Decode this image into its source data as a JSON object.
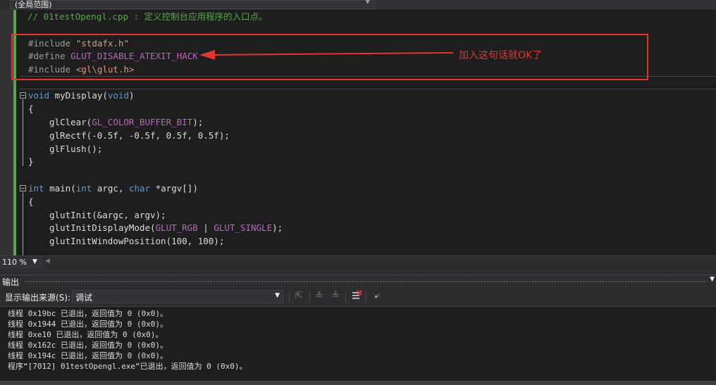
{
  "scope_bar": {
    "selected": "(全局范围)"
  },
  "editor": {
    "comment": "// 01testOpengl.cpp : 定义控制台应用程序的入口点。",
    "include1_kw": "#include",
    "include1_file": "\"stdafx.h\"",
    "define_kw": "#define",
    "define_macro": "GLUT_DISABLE_ATEXIT_HACK",
    "include2_kw": "#include",
    "include2_file": "<gl\\glut.h>",
    "fn1_ret": "void",
    "fn1_name": " myDisplay(",
    "fn1_param": "void",
    "fn1_close": ")",
    "open_brace": "{",
    "close_brace": "}",
    "glclear_a": "glClear(",
    "glclear_macro": "GL_COLOR_BUFFER_BIT",
    "glclear_b": ");",
    "glrectf": "glRectf(-0.5f, -0.5f, 0.5f, 0.5f);",
    "glflush": "glFlush();",
    "main_ret": "int",
    "main_name": " main(",
    "main_int": "int",
    "main_argc": " argc, ",
    "main_char": "char",
    "main_argv": " *argv[])",
    "glutinit": "glutInit(&argc, argv);",
    "dispmode_a": "glutInitDisplayMode(",
    "dispmode_m1": "GLUT_RGB",
    "dispmode_pipe": " | ",
    "dispmode_m2": "GLUT_SINGLE",
    "dispmode_b": ");",
    "winpos": "glutInitWindowPosition(100, 100);"
  },
  "annotation": {
    "text": "加入这句话就OK了",
    "color": "#e2362e"
  },
  "zoom": {
    "value": "110 %"
  },
  "output": {
    "title": "输出",
    "source_label": "显示输出来源(S):",
    "source_value": "调试",
    "lines": [
      "线程 0x19bc 已退出，返回值为 0 (0x0)。",
      "线程 0x1944 已退出，返回值为 0 (0x0)。",
      "线程 0xe10 已退出，返回值为 0 (0x0)。",
      "线程 0x162c 已退出，返回值为 0 (0x0)。",
      "线程 0x194c 已退出，返回值为 0 (0x0)。",
      "程序“[7012] 01testOpengl.exe”已退出，返回值为 0 (0x0)。"
    ]
  },
  "icons": {
    "find_message": "find-message-icon",
    "prev_message": "previous-message-icon",
    "next_message": "next-message-icon",
    "clear_all": "clear-all-icon",
    "word_wrap": "word-wrap-icon"
  },
  "colors": {
    "editor_bg": "#1e1e1e",
    "keyword": "#569cd6",
    "macro": "#bd63c5",
    "string": "#d69d85",
    "comment": "#57a64a"
  }
}
